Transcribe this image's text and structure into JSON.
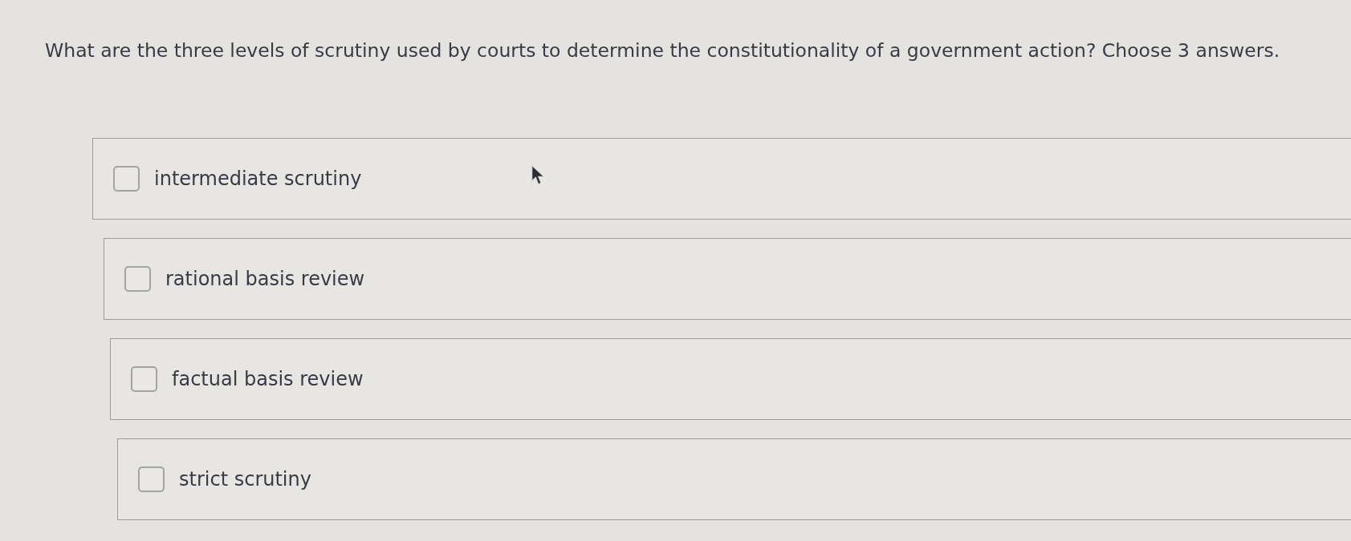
{
  "question": {
    "text": "What are the three levels of scrutiny used by courts to determine the constitutionality of a government action? Choose 3 answers."
  },
  "options": [
    {
      "label": "intermediate scrutiny",
      "checked": false
    },
    {
      "label": "rational basis review",
      "checked": false
    },
    {
      "label": "factual basis review",
      "checked": false
    },
    {
      "label": "strict scrutiny",
      "checked": false
    }
  ]
}
